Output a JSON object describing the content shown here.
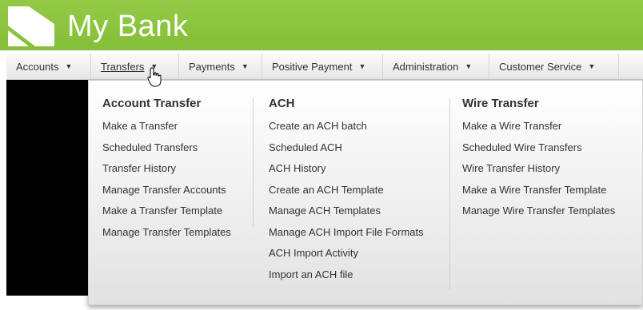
{
  "header": {
    "title": "My Bank",
    "brand_color": "#8cc63f",
    "logo_icon": "bank-logo-icon"
  },
  "nav": {
    "items": [
      {
        "label": "Accounts"
      },
      {
        "label": "Transfers"
      },
      {
        "label": "Payments"
      },
      {
        "label": "Positive Payment"
      },
      {
        "label": "Administration"
      },
      {
        "label": "Customer Service"
      }
    ],
    "active": "Transfers"
  },
  "dropdown": {
    "columns": [
      {
        "title": "Account Transfer",
        "links": [
          "Make a Transfer",
          "Scheduled Transfers",
          "Transfer History",
          "Manage Transfer Accounts",
          "Make a Transfer Template",
          "Manage Transfer Templates"
        ]
      },
      {
        "title": "ACH",
        "links": [
          "Create an ACH batch",
          "Scheduled ACH",
          "ACH History",
          "Create an ACH Template",
          "Manage ACH Templates",
          "Manage ACH Import File Formats",
          "ACH Import Activity",
          "Import an ACH file"
        ]
      },
      {
        "title": "Wire Transfer",
        "links": [
          "Make a Wire Transfer",
          "Scheduled Wire Transfers",
          "Wire Transfer History",
          "Make a Wire Transfer Template",
          "Manage Wire Transfer Templates"
        ]
      }
    ]
  }
}
